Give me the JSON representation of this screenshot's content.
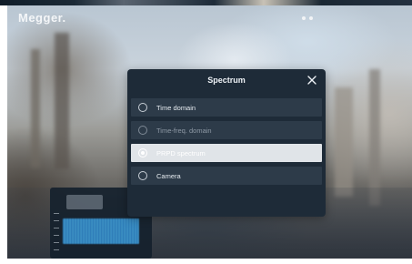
{
  "app": {
    "logo_text": "Megger."
  },
  "dialog": {
    "title": "Spectrum",
    "close_icon": "close-icon",
    "options": [
      {
        "label": "Time domain",
        "state": "default"
      },
      {
        "label": "Time-freq. domain",
        "state": "disabled"
      },
      {
        "label": "PRPD spectrum",
        "state": "selected"
      },
      {
        "label": "Camera",
        "state": "default"
      }
    ]
  },
  "colors": {
    "dialog_bg": "#1e2b38",
    "option_bg": "#2d3b49",
    "option_selected_bg": "#e0e4e8",
    "text_primary": "#eef2f6",
    "text_muted": "#8e99a5"
  }
}
